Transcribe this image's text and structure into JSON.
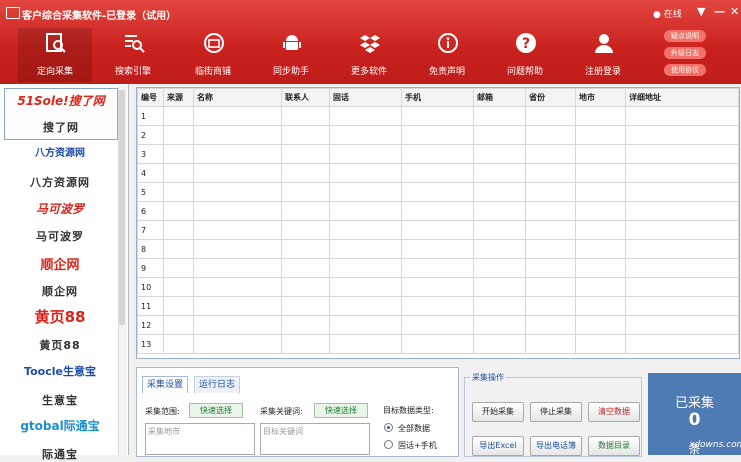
{
  "window": {
    "title": "客户综合采集软件-已登录（试用）",
    "online_status": "在线",
    "side_links": [
      "疑点说明",
      "升级日志",
      "使用协议"
    ]
  },
  "toolbar": [
    {
      "label": "定向采集",
      "icon": "magnifier-doc-icon",
      "active": true
    },
    {
      "label": "搜索引擎",
      "icon": "search-engine-icon",
      "active": false
    },
    {
      "label": "临街商铺",
      "icon": "storefront-icon",
      "active": false
    },
    {
      "label": "同步助手",
      "icon": "android-icon",
      "active": false
    },
    {
      "label": "更多软件",
      "icon": "dropbox-icon",
      "active": false
    },
    {
      "label": "免责声明",
      "icon": "info-icon",
      "active": false
    },
    {
      "label": "问题帮助",
      "icon": "question-icon",
      "active": false
    },
    {
      "label": "注册登录",
      "icon": "user-icon",
      "active": false
    }
  ],
  "vendors": [
    {
      "logo": "51Sole!搜了网",
      "name": "搜了网",
      "selected": true
    },
    {
      "logo": "八方资源网",
      "name": "八方资源网",
      "selected": false
    },
    {
      "logo": "马可波罗",
      "name": "马可波罗",
      "selected": false
    },
    {
      "logo": "顺企网",
      "name": "顺企网",
      "selected": false
    },
    {
      "logo": "黄页88",
      "name": "黄页88",
      "selected": false
    },
    {
      "logo": "Toocle生意宝",
      "name": "生意宝",
      "selected": false
    },
    {
      "logo": "gtobal际通宝",
      "name": "际通宝",
      "selected": false
    }
  ],
  "table": {
    "columns": [
      "编号",
      "来源",
      "名称",
      "联系人",
      "固话",
      "手机",
      "邮箱",
      "省份",
      "地市",
      "详细地址"
    ],
    "rows": [
      "1",
      "2",
      "3",
      "4",
      "5",
      "6",
      "7",
      "8",
      "9",
      "10",
      "11",
      "12",
      "13"
    ]
  },
  "settings": {
    "tabs": [
      "采集设置",
      "运行日志"
    ],
    "range_label": "采集范围:",
    "range_button": "快速选择",
    "range_placeholder": "采集地市",
    "keyword_label": "采集关键词:",
    "keyword_button": "快速选择",
    "keyword_placeholder": "目标关键词",
    "target_label": "目标数据类型:",
    "target_options": [
      {
        "label": "全部数据",
        "checked": true
      },
      {
        "label": "固话+手机",
        "checked": false
      }
    ]
  },
  "ops": {
    "title": "采集操作",
    "buttons": [
      "开始采集",
      "停止采集",
      "清空数据",
      "导出Excel",
      "导出电话簿",
      "数据目录"
    ]
  },
  "collected": {
    "label": "已采集",
    "value": "0",
    "unit": "条"
  },
  "colors": {
    "title_bar": "#c9211d",
    "accent_blue": "#4f7bb4",
    "link_blue": "#1b4f9c",
    "danger_red": "#c9211d"
  },
  "watermark": "xdowns.com"
}
